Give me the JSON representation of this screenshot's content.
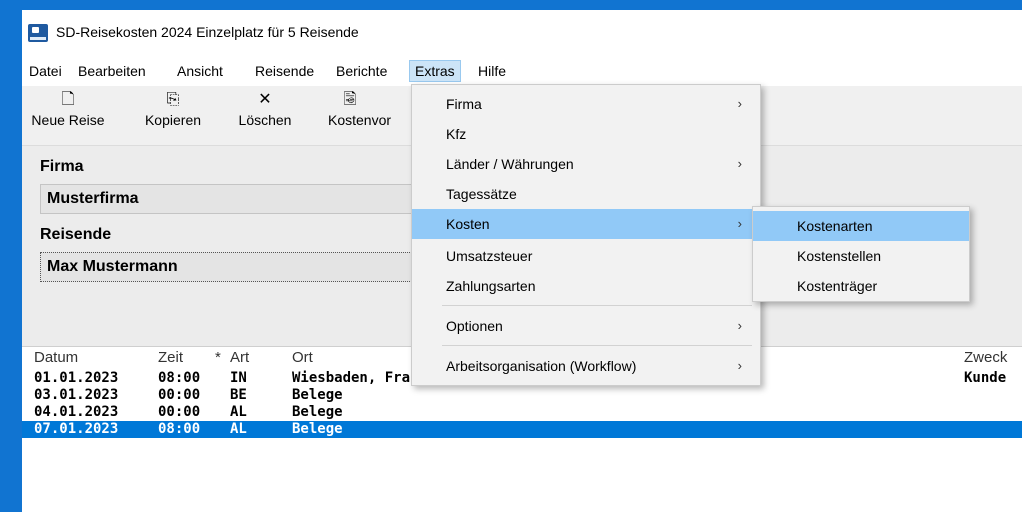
{
  "window": {
    "title": "SD-Reisekosten 2024 Einzelplatz für 5 Reisende"
  },
  "menubar": {
    "items": [
      "Datei",
      "Bearbeiten",
      "Ansicht",
      "Reisende",
      "Berichte",
      "Extras",
      "Hilfe"
    ]
  },
  "toolbar": {
    "buttons": [
      {
        "label": "Neue Reise",
        "icon": "new-document-icon"
      },
      {
        "label": "Kopieren",
        "icon": "copy-icon"
      },
      {
        "label": "Löschen",
        "icon": "delete-x-icon"
      },
      {
        "label": "Kostenvor",
        "icon": "preview-icon"
      }
    ]
  },
  "form": {
    "firma_label": "Firma",
    "firma_value": "Musterfirma",
    "reisende_label": "Reisende",
    "reisende_value": "Max Mustermann"
  },
  "list": {
    "headers": [
      "Datum",
      "Zeit",
      "*",
      "Art",
      "Ort",
      "Zweck"
    ],
    "rows": [
      {
        "datum": "01.01.2023",
        "zeit": "08:00",
        "art": "IN",
        "ort": "Wiesbaden, Frankfurt",
        "zweck": "Kunde",
        "selected": false
      },
      {
        "datum": "03.01.2023",
        "zeit": "00:00",
        "art": "BE",
        "ort": "Belege",
        "zweck": "",
        "selected": false
      },
      {
        "datum": "04.01.2023",
        "zeit": "00:00",
        "art": "AL",
        "ort": "Belege",
        "zweck": "",
        "selected": false
      },
      {
        "datum": "07.01.2023",
        "zeit": "08:00",
        "art": "AL",
        "ort": "Belege",
        "zweck": "",
        "selected": true
      }
    ]
  },
  "extras_menu": {
    "items": [
      {
        "label": "Firma",
        "submenu": true
      },
      {
        "label": "Kfz",
        "submenu": false
      },
      {
        "label": "Länder / Währungen",
        "submenu": true
      },
      {
        "label": "Tagessätze",
        "submenu": false
      },
      {
        "label": "Kosten",
        "submenu": true,
        "highlighted": true
      },
      {
        "label": "Umsatzsteuer",
        "submenu": false
      },
      {
        "label": "Zahlungsarten",
        "submenu": false
      },
      {
        "label": "Optionen",
        "submenu": true
      },
      {
        "label": "Arbeitsorganisation (Workflow)",
        "submenu": true
      }
    ],
    "arrow_glyph": "›"
  },
  "kosten_submenu": {
    "items": [
      {
        "label": "Kostenarten",
        "highlighted": true
      },
      {
        "label": "Kostenstellen",
        "highlighted": false
      },
      {
        "label": "Kostenträger",
        "highlighted": false
      }
    ]
  },
  "colors": {
    "window_border": "#1174d1",
    "selection": "#0078d7",
    "menu_highlight": "#91c9f7",
    "menu_bar_active": "#cce4f7"
  }
}
